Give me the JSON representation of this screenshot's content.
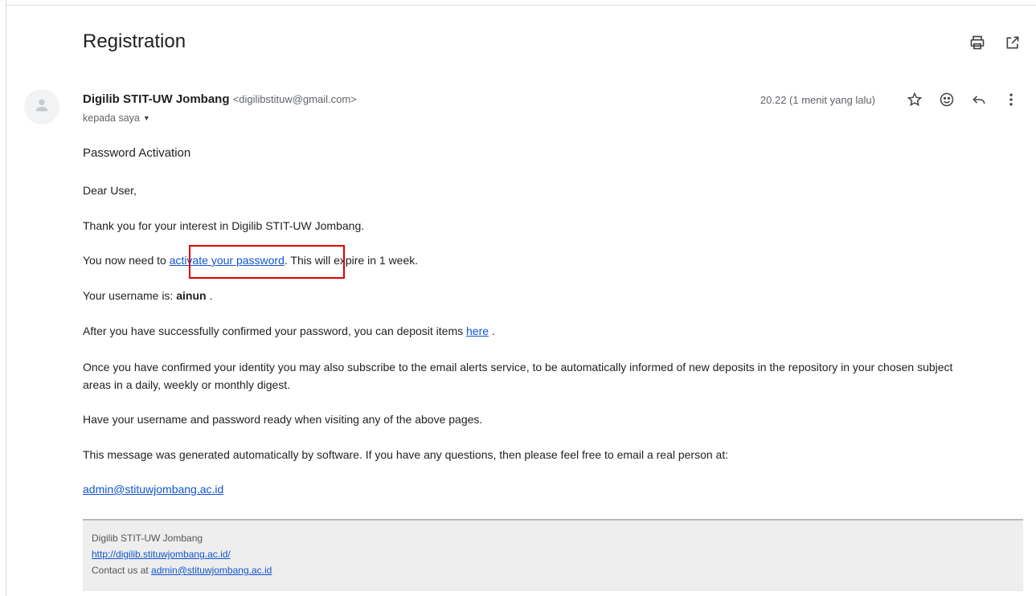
{
  "email": {
    "subject": "Registration",
    "sender": {
      "name": "Digilib STIT-UW Jombang",
      "email": "<digilibstituw@gmail.com>"
    },
    "recipient": "kepada saya",
    "timestamp": "20.22 (1 menit yang lalu)"
  },
  "icons": {
    "print": "print-icon",
    "popout": "open-in-new-window-icon",
    "star": "star-icon",
    "emoji": "emoji-icon",
    "reply": "reply-icon",
    "more": "more-vertical-icon",
    "avatar": "person-icon"
  },
  "body": {
    "title": "Password Activation",
    "greeting": "Dear User,",
    "thanks": "Thank you for your interest in Digilib STIT-UW Jombang.",
    "activate_pre": "You now need to ",
    "activate_link": "activate your password",
    "activate_post": ". This will expire in 1 week.",
    "username_pre": "Your username is: ",
    "username": "ainun",
    "username_post": " .",
    "deposit_pre": "After you have successfully confirmed your password, you can deposit items ",
    "deposit_link": "here",
    "deposit_post": " .",
    "alerts": "Once you have confirmed your identity you may also subscribe to the email alerts service, to be automatically informed of new deposits in the repository in your chosen subject areas in a daily, weekly or monthly digest.",
    "ready": "Have your username and password ready when visiting any of the above pages.",
    "auto": "This message was generated automatically by software. If you have any questions, then please feel free to email a real person at:",
    "admin_link": "admin@stituwjombang.ac.id"
  },
  "footer": {
    "org": "Digilib STIT-UW Jombang",
    "url": "http://digilib.stituwjombang.ac.id/",
    "contact_pre": "Contact us at ",
    "contact_link": "admin@stituwjombang.ac.id"
  },
  "colors": {
    "link": "#1155cc",
    "highlight": "#e00000",
    "footer_bg": "#eeeeee"
  }
}
